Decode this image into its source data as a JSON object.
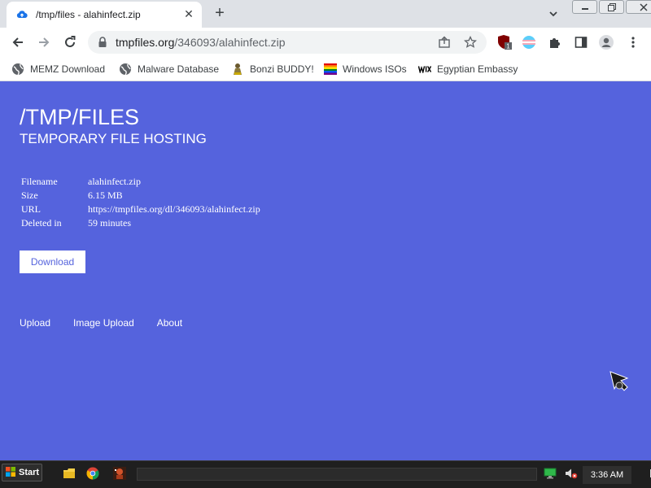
{
  "browser": {
    "tab": {
      "title": "/tmp/files - alahinfect.zip"
    },
    "address": {
      "domain": "tmpfiles.org",
      "path": "/346093/alahinfect.zip"
    },
    "bookmarks": [
      {
        "label": "MEMZ Download",
        "icon": "globe-icon"
      },
      {
        "label": "Malware Database",
        "icon": "globe-icon"
      },
      {
        "label": "Bonzi BUDDY!",
        "icon": "bonzi-icon"
      },
      {
        "label": "Windows ISOs",
        "icon": "rainbow-flag-icon"
      },
      {
        "label": "Egyptian Embassy",
        "icon": "wix-icon"
      }
    ],
    "extension_badge": "1"
  },
  "page": {
    "title": "/TMP/FILES",
    "subtitle": "TEMPORARY FILE HOSTING",
    "file_info": [
      {
        "label": "Filename",
        "value": "alahinfect.zip"
      },
      {
        "label": "Size",
        "value": "6.15 MB"
      },
      {
        "label": "URL",
        "value": "https://tmpfiles.org/dl/346093/alahinfect.zip"
      },
      {
        "label": "Deleted in",
        "value": "59 minutes"
      }
    ],
    "download_label": "Download",
    "footer_links": [
      "Upload",
      "Image Upload",
      "About"
    ]
  },
  "taskbar": {
    "start_label": "Start",
    "clock": "3:36 AM"
  },
  "colors": {
    "page_bg": "#5563dd",
    "button_text": "#5563dd"
  }
}
